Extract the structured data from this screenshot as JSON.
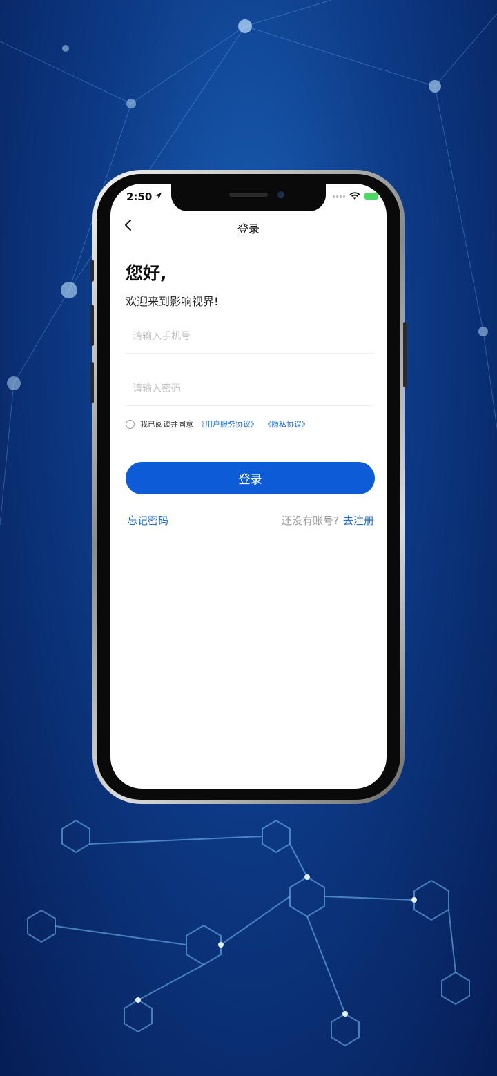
{
  "status": {
    "time": "2:50"
  },
  "nav": {
    "title": "登录"
  },
  "greeting": {
    "hello": "您好,",
    "welcome": "欢迎来到影响视界!"
  },
  "form": {
    "phone_placeholder": "请输入手机号",
    "password_placeholder": "请输入密码"
  },
  "agreement": {
    "prefix": "我已阅读并同意",
    "user_service": "《用户服务协议》",
    "privacy": "《隐私协议》"
  },
  "login_button": "登录",
  "links": {
    "forgot_password": "忘记密码",
    "no_account": "还没有账号?",
    "register": "去注册"
  },
  "colors": {
    "primary": "#0b5cd6",
    "link": "#1e6fd8",
    "background": "#0d3a86"
  },
  "icons": [
    "back-chevron-icon",
    "location-arrow-icon",
    "wifi-icon",
    "battery-icon",
    "radio-unchecked-icon"
  ]
}
